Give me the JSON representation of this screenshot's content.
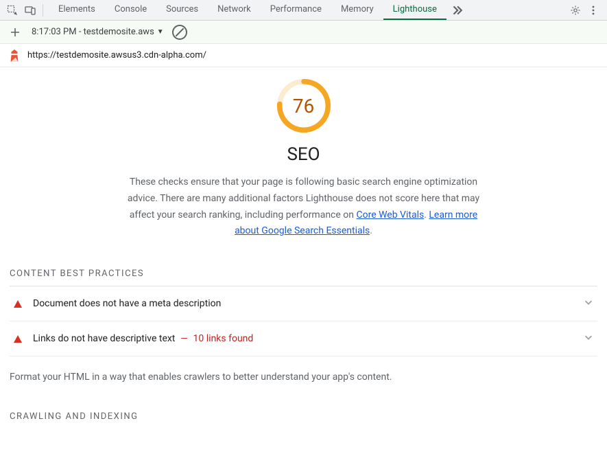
{
  "tabs": [
    "Elements",
    "Console",
    "Sources",
    "Network",
    "Performance",
    "Memory",
    "Lighthouse"
  ],
  "active_tab_index": 6,
  "toolbar": {
    "report_label": "8:17:03 PM - testdemosite.aws"
  },
  "url": "https://testdemosite.awsus3.cdn-alpha.com/",
  "score": {
    "value": "76",
    "title": "SEO",
    "percent": 76,
    "color": "#f5a623",
    "description_pre": "These checks ensure that your page is following basic search engine optimization advice. There are many additional factors Lighthouse does not score here that may affect your search ranking, including performance on ",
    "link1": "Core Web Vitals",
    "mid": ". ",
    "link2": "Learn more about Google Search Essentials",
    "suffix": "."
  },
  "sections": {
    "content": {
      "title": "CONTENT BEST PRACTICES",
      "audits": [
        {
          "label": "Document does not have a meta description",
          "extra": null
        },
        {
          "label": "Links do not have descriptive text",
          "extra": "10 links found"
        }
      ],
      "note": "Format your HTML in a way that enables crawlers to better understand your app's content."
    },
    "crawling": {
      "title": "CRAWLING AND INDEXING"
    }
  }
}
